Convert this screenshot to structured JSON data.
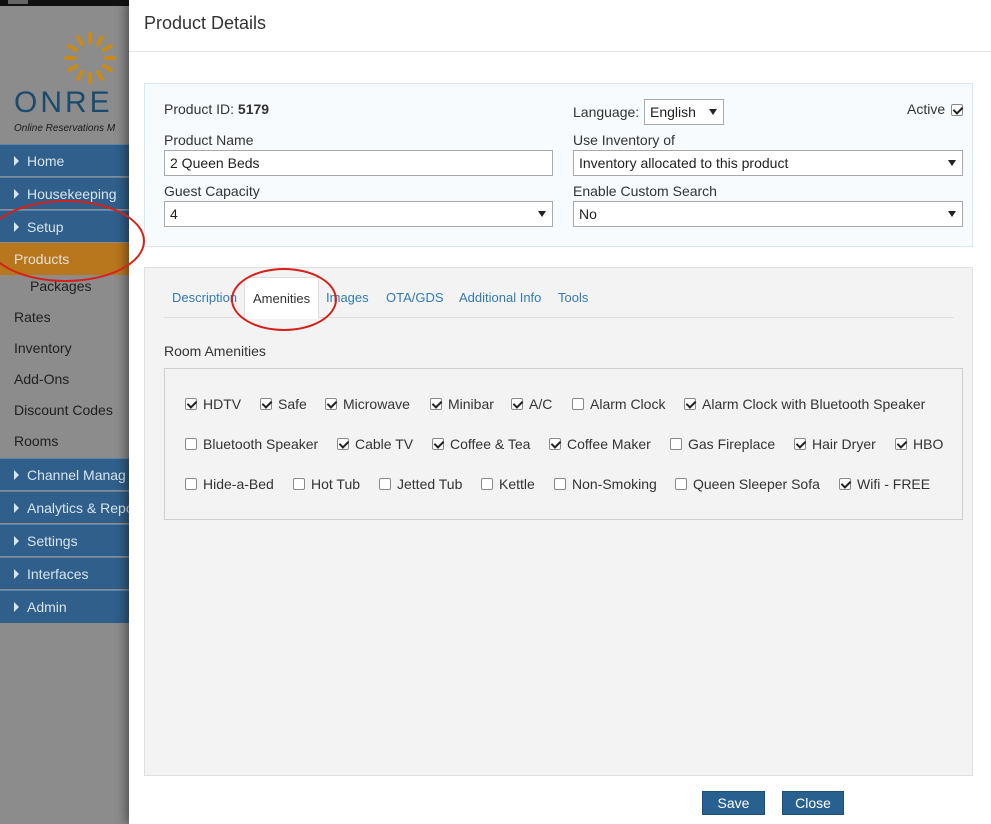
{
  "sidebar": {
    "logo_text": "ONRE",
    "logo_tagline": "Online Reservations M",
    "items": [
      {
        "label": "Home"
      },
      {
        "label": "Housekeeping"
      },
      {
        "label": "Setup"
      },
      {
        "label": "Products"
      },
      {
        "label": "Packages"
      },
      {
        "label": "Rates"
      },
      {
        "label": "Inventory"
      },
      {
        "label": "Add-Ons"
      },
      {
        "label": "Discount Codes"
      },
      {
        "label": "Rooms"
      },
      {
        "label": "Channel Manag"
      },
      {
        "label": "Analytics & Repo"
      },
      {
        "label": "Settings"
      },
      {
        "label": "Interfaces"
      },
      {
        "label": "Admin"
      }
    ]
  },
  "modal": {
    "title": "Product Details",
    "product_id_label": "Product ID:",
    "product_id_value": "5179",
    "language_label": "Language:",
    "language_value": "English",
    "active_label": "Active",
    "active_checked": true,
    "product_name_label": "Product Name",
    "product_name_value": "2 Queen Beds",
    "use_inventory_label": "Use Inventory of",
    "use_inventory_value": "Inventory allocated to this product",
    "guest_capacity_label": "Guest Capacity",
    "guest_capacity_value": "4",
    "custom_search_label": "Enable Custom Search",
    "custom_search_value": "No",
    "tabs": [
      {
        "label": "Description"
      },
      {
        "label": "Amenities"
      },
      {
        "label": "Images"
      },
      {
        "label": "OTA/GDS"
      },
      {
        "label": "Additional Info"
      },
      {
        "label": "Tools"
      }
    ],
    "active_tab": "Amenities",
    "room_amenities_title": "Room Amenities",
    "amenities": [
      {
        "label": "HDTV",
        "checked": true
      },
      {
        "label": "Safe",
        "checked": true
      },
      {
        "label": "Microwave",
        "checked": true
      },
      {
        "label": "Minibar",
        "checked": true
      },
      {
        "label": "A/C",
        "checked": true
      },
      {
        "label": "Alarm Clock",
        "checked": false
      },
      {
        "label": "Alarm Clock with Bluetooth Speaker",
        "checked": true
      },
      {
        "label": "Bluetooth Speaker",
        "checked": false
      },
      {
        "label": "Cable TV",
        "checked": true
      },
      {
        "label": "Coffee & Tea",
        "checked": true
      },
      {
        "label": "Coffee Maker",
        "checked": true
      },
      {
        "label": "Gas Fireplace",
        "checked": false
      },
      {
        "label": "Hair Dryer",
        "checked": true
      },
      {
        "label": "HBO",
        "checked": true
      },
      {
        "label": "Hide-a-Bed",
        "checked": false
      },
      {
        "label": "Hot Tub",
        "checked": false
      },
      {
        "label": "Jetted Tub",
        "checked": false
      },
      {
        "label": "Kettle",
        "checked": false
      },
      {
        "label": "Non-Smoking",
        "checked": false
      },
      {
        "label": "Queen Sleeper Sofa",
        "checked": false
      },
      {
        "label": "Wifi - FREE",
        "checked": true
      }
    ],
    "save_label": "Save",
    "close_label": "Close"
  },
  "colors": {
    "nav_blue": "#2f5f8a",
    "nav_active": "#b8771c",
    "link_blue": "#337ab7",
    "button_blue": "#286090",
    "annotation_red": "#d6201a"
  }
}
